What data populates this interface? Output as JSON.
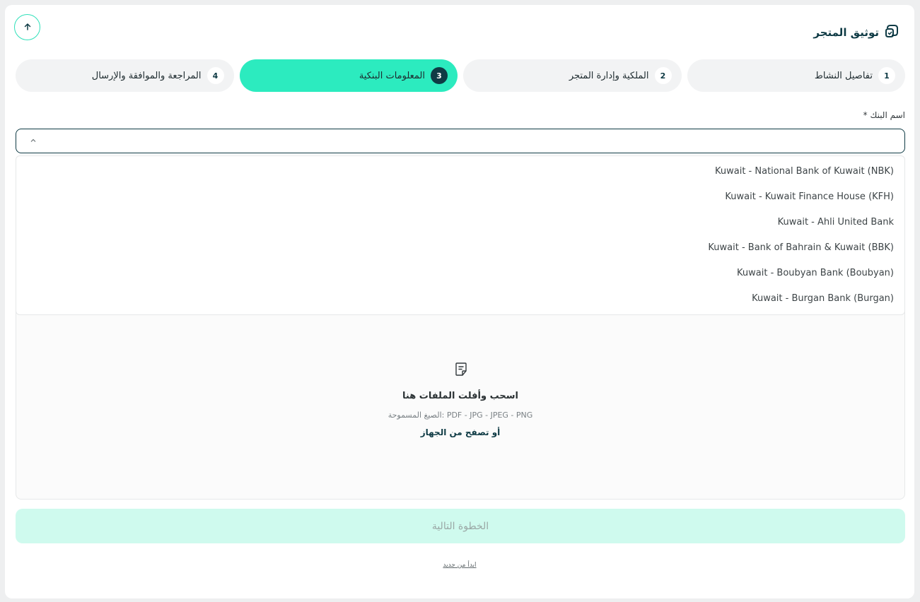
{
  "header": {
    "title": "توثيق المتجر"
  },
  "steps": [
    {
      "number": "1",
      "label": "تفاصيل النشاط",
      "active": false
    },
    {
      "number": "2",
      "label": "الملكية وإدارة المتجر",
      "active": false
    },
    {
      "number": "3",
      "label": "المعلومات البنكية",
      "active": true
    },
    {
      "number": "4",
      "label": "المراجعة والموافقة والإرسال",
      "active": false
    }
  ],
  "bank_field": {
    "label": "اسم البنك *",
    "value": "",
    "options": [
      "Kuwait - National Bank of Kuwait (NBK)",
      "Kuwait - Kuwait Finance House (KFH)",
      "Kuwait - Ahli United Bank",
      "Kuwait - Bank of Bahrain & Kuwait (BBK)",
      "Kuwait - Boubyan Bank (Boubyan)",
      "Kuwait - Burgan Bank (Burgan)"
    ]
  },
  "upload": {
    "title": "اسحب وأفلت الملفات هنا",
    "formats": "الصيغ المسموحة: PDF - JPG - JPEG - PNG",
    "browse": "أو تصفح من الجهاز"
  },
  "actions": {
    "next_label": "الخطوة التالية",
    "restart_label": "ابدأ من جديد"
  },
  "colors": {
    "accent": "#2cebbf",
    "brand_dark": "#0f3b45",
    "next_disabled_bg": "#cffaee"
  },
  "icons": [
    "store-verify-icon",
    "arrow-up-icon",
    "chevron-up-icon",
    "document-icon"
  ]
}
